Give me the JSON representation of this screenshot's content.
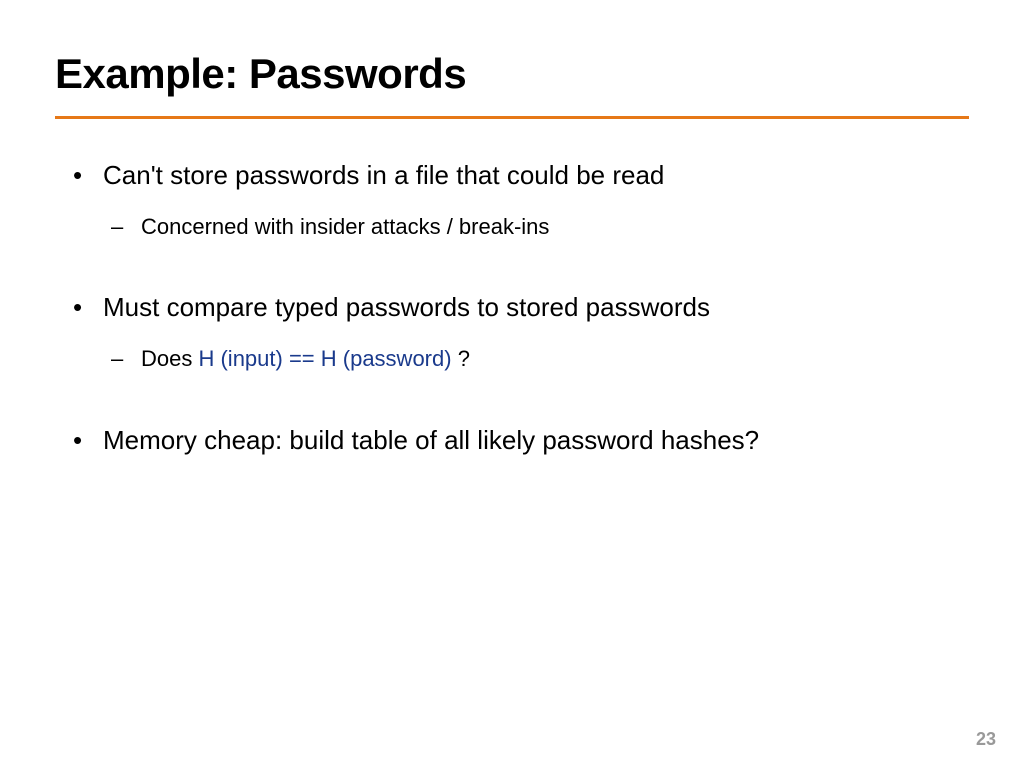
{
  "title": "Example:  Passwords",
  "bullets": [
    {
      "text": "Can't store passwords in a file that could be read",
      "sub": [
        {
          "text": "Concerned with insider attacks / break-ins"
        }
      ]
    },
    {
      "text": "Must compare typed passwords to stored passwords",
      "sub": [
        {
          "prefix": "Does ",
          "highlight": "H (input) == H (password)",
          "suffix": " ?"
        }
      ]
    },
    {
      "text": "Memory cheap: build table of all likely password hashes?",
      "sub": []
    }
  ],
  "page_number": "23",
  "colors": {
    "accent": "#e67817",
    "highlight": "#1a3a8c"
  }
}
